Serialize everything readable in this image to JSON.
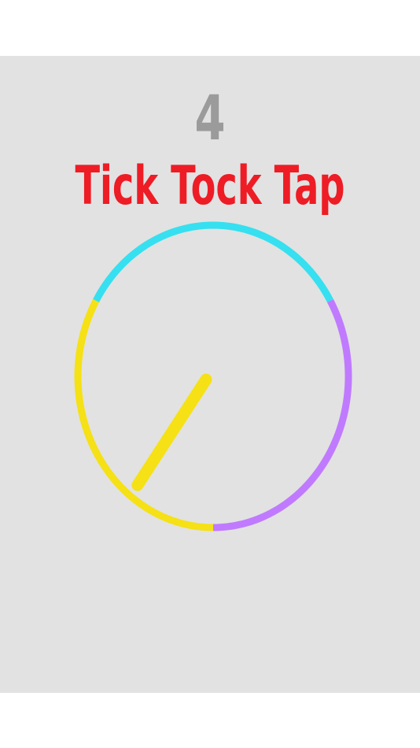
{
  "game": {
    "score": "4",
    "title": "Tick Tock Tap"
  },
  "colors": {
    "background": "#e2e2e2",
    "score": "#9b9b9b",
    "title": "#ee1c25",
    "ring_cyan": "#36e0f0",
    "ring_purple": "#c07aff",
    "ring_yellow": "#f5e115",
    "hand": "#f5e115"
  },
  "ring_segments": [
    {
      "color": "cyan",
      "from_deg": -60,
      "to_deg": 60
    },
    {
      "color": "purple",
      "from_deg": 60,
      "to_deg": 180
    },
    {
      "color": "yellow",
      "from_deg": 180,
      "to_deg": 300
    }
  ],
  "hand": {
    "color": "yellow",
    "angle_deg": 213
  }
}
